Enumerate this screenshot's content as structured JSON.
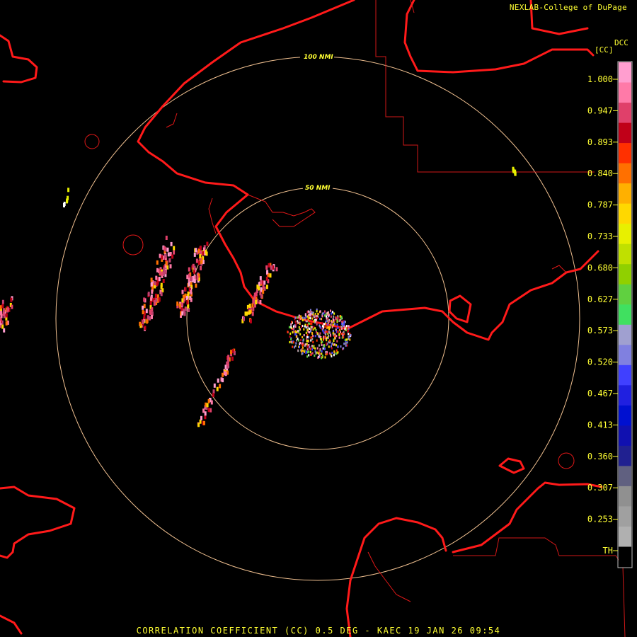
{
  "header": {
    "credit": "NEXLAB-College of DuPage"
  },
  "colorbar": {
    "title": "DCC",
    "unit": "[CC]",
    "ticks": [
      "1.000",
      "0.947",
      "0.893",
      "0.840",
      "0.787",
      "0.733",
      "0.680",
      "0.627",
      "0.573",
      "0.520",
      "0.467",
      "0.413",
      "0.360",
      "0.307",
      "0.253",
      "TH"
    ],
    "colors": [
      "#ff9ecf",
      "#ff7aa8",
      "#e0406a",
      "#c00018",
      "#ff3000",
      "#ff7000",
      "#ffb000",
      "#ffd800",
      "#e8f000",
      "#c0e000",
      "#90d000",
      "#60d040",
      "#40e060",
      "#a0a0d0",
      "#8080e0",
      "#4040ff",
      "#2020e0",
      "#0010d0",
      "#1010b0",
      "#202090",
      "#606080",
      "#909090",
      "#a0a0a0",
      "#b0b0b0",
      "#000000"
    ]
  },
  "range_rings": [
    {
      "label": "100 NMI"
    },
    {
      "label": "50 NMI"
    }
  ],
  "footer": {
    "text": "CORRELATION COEFFICIENT (CC) 0.5 DEG - KAEC 19 JAN 26 09:54"
  },
  "colors": {
    "coast": "#ff1a1a",
    "ring": "#f0c090",
    "text": "#ffff33",
    "background": "#000000"
  }
}
